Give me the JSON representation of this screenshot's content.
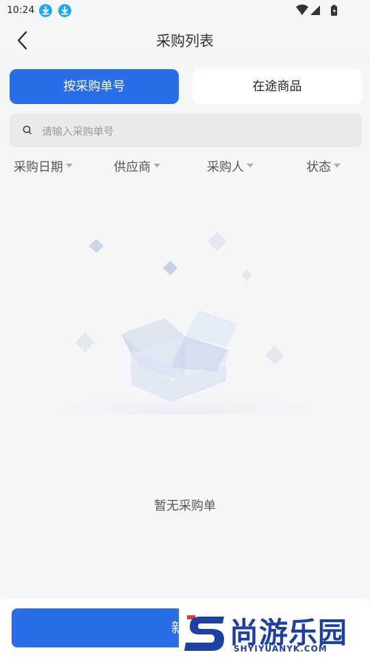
{
  "status_bar": {
    "time": "10:24"
  },
  "nav": {
    "title": "采购列表"
  },
  "tabs": [
    {
      "label": "按采购单号",
      "active": true
    },
    {
      "label": "在途商品",
      "active": false
    }
  ],
  "search": {
    "placeholder": "请输入采购单号",
    "value": ""
  },
  "filters": [
    {
      "label": "采购日期"
    },
    {
      "label": "供应商"
    },
    {
      "label": "采购人"
    },
    {
      "label": "状态"
    }
  ],
  "empty_state": {
    "message": "暂无采购单"
  },
  "bottom": {
    "new_button_label": "新建"
  },
  "watermark": {
    "brand": "尚游乐园",
    "url": "SHYIYUANYK.COM"
  },
  "colors": {
    "accent": "#2a6de9",
    "background": "#f5f6f8",
    "download_icon": "#1fa8f0"
  },
  "icons": [
    "download-icon",
    "wifi-icon",
    "signal-icon",
    "battery-icon",
    "back-arrow-icon",
    "search-icon",
    "caret-down-icon",
    "empty-box-icon"
  ]
}
